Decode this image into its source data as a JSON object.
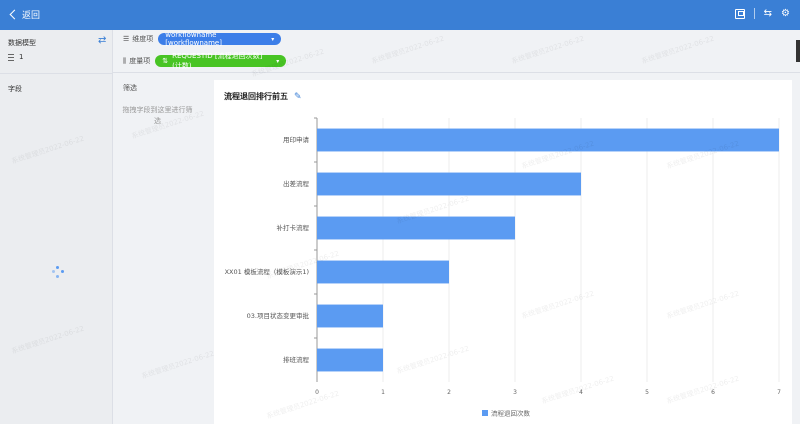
{
  "header": {
    "back_label": "返回"
  },
  "left_panel": {
    "title": "数据模型",
    "model_item": "1",
    "fields_title": "字段"
  },
  "config": {
    "dimension_label": "维度项",
    "dimension_value": "workflowname [workflowname]",
    "measure_label": "度量项",
    "measure_value": "REQUESTID [流程退回次数] (计数)"
  },
  "filter": {
    "title": "筛选",
    "hint": "拖拽字段到这里进行筛选"
  },
  "card": {
    "title": "流程退回排行前五"
  },
  "colors": {
    "accent": "#3a7fd5",
    "bar": "#5b9bf2",
    "measure_pill": "#48c424"
  },
  "watermark": "系统管理员2022-06-22",
  "chart_data": {
    "type": "bar",
    "orientation": "horizontal",
    "categories": [
      "用印申请",
      "出差流程",
      "补打卡流程",
      "XX01 模板流程（模板演示1)",
      "03.项目状态变更审批",
      "排班流程"
    ],
    "series": [
      {
        "name": "流程退回次数",
        "values": [
          7,
          4,
          3,
          2,
          1,
          1
        ]
      }
    ],
    "xlim": [
      0,
      7
    ],
    "xticks": [
      0,
      1,
      2,
      3,
      4,
      5,
      6,
      7
    ],
    "grid": true,
    "legend": "bottom"
  }
}
